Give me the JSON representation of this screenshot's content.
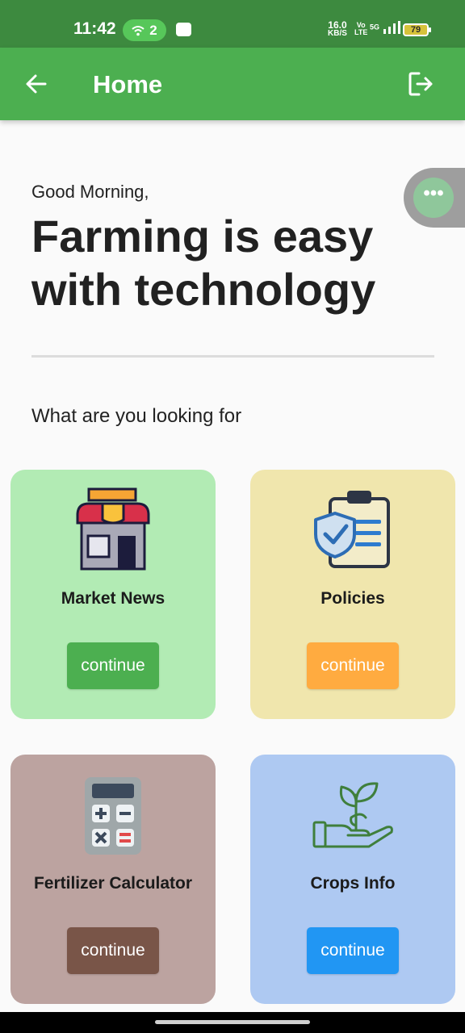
{
  "status_bar": {
    "time": "11:42",
    "hotspot_count": "2",
    "net_speed_value": "16.0",
    "net_speed_unit": "KB/S",
    "volte_top": "Vo",
    "volte_bottom": "LTE",
    "signal_label": "5G",
    "battery": "79"
  },
  "app_bar": {
    "title": "Home",
    "back_icon": "arrow-left-icon",
    "logout_icon": "logout-icon",
    "color": "#4caf50"
  },
  "floating_button": {
    "icon": "more-horizontal-icon",
    "glyph": "•••"
  },
  "greeting": "Good Morning,",
  "headline": "Farming is easy with technology",
  "section_title": "What are you looking for",
  "cards": [
    {
      "title": "Market News",
      "button": "continue",
      "icon": "shop-icon",
      "bg": "#b2ebb4",
      "button_color": "#4caf50"
    },
    {
      "title": "Policies",
      "button": "continue",
      "icon": "clipboard-shield-icon",
      "bg": "#f0e6ad",
      "button_color": "#ffab40"
    },
    {
      "title": "Fertilizer Calculator",
      "button": "continue",
      "icon": "calculator-icon",
      "bg": "#bca3a0",
      "button_color": "#795548"
    },
    {
      "title": "Crops Info",
      "button": "continue",
      "icon": "plant-in-hand-icon",
      "bg": "#aec9f2",
      "button_color": "#2196f3"
    }
  ]
}
